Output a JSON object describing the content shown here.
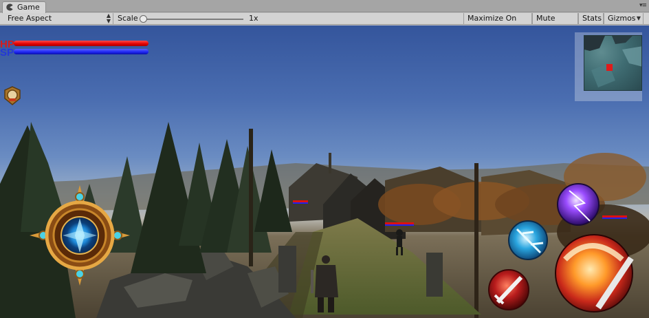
{
  "window": {
    "tab_label": "Game",
    "tab_icon": "game-pacman-icon",
    "tab_menu_icon": "more-menu-icon"
  },
  "toolbar": {
    "aspect": "Free Aspect",
    "scale_label": "Scale",
    "scale_value": "1x",
    "scale_fraction": 0.0,
    "maximize_on_play": "Maximize On Play",
    "mute_audio": "Mute Audio",
    "stats": "Stats",
    "gizmos": "Gizmos"
  },
  "hud": {
    "hp_label": "HP",
    "sp_label": "SP",
    "hp_fraction": 1.0,
    "sp_fraction": 1.0,
    "hp_color": "#e00000",
    "sp_color": "#1c24f0",
    "marker_color": "#e01b1b"
  },
  "controls": {
    "joystick_icon": "virtual-joystick-icon",
    "skill_icons": [
      "lightning-skill-icon",
      "ice-shard-skill-icon",
      "sword-slash-skill-icon",
      "fire-slash-attack-icon"
    ],
    "badge_icon": "treasure-badge-icon"
  }
}
